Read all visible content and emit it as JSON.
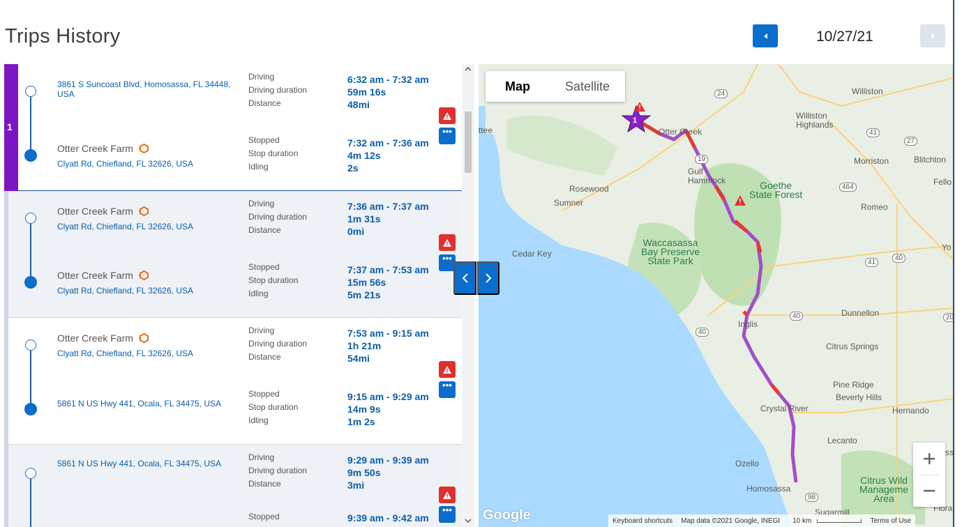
{
  "header": {
    "title": "Trips History",
    "date": "10/27/21"
  },
  "colors": {
    "accent": "#0b6dcc",
    "trip_highlight": "#7c16c4",
    "route": "#a24fc9",
    "route_alert": "#e8392f",
    "water": "#aadaff",
    "alert": "#e0302e"
  },
  "trips": [
    {
      "number": "1",
      "start_address": "3861 S Suncoast Blvd, Homosassa, FL 34448, USA",
      "drive_labels": [
        "Driving",
        "Driving duration",
        "Distance"
      ],
      "drive_values": [
        "6:32 am - 7:32 am",
        "59m 16s",
        "48mi"
      ],
      "stop_place": "Otter Creek Farm",
      "stop_address": "Clyatt Rd, Chiefland, FL 32626, USA",
      "stop_labels": [
        "Stopped",
        "Stop duration",
        "Idling"
      ],
      "stop_values": [
        "7:32 am - 7:36 am",
        "4m 12s",
        "2s"
      ]
    },
    {
      "start_place": "Otter Creek Farm",
      "start_address": "Clyatt Rd, Chiefland, FL 32626, USA",
      "drive_labels": [
        "Driving",
        "Driving duration",
        "Distance"
      ],
      "drive_values": [
        "7:36 am - 7:37 am",
        "1m 31s",
        "0mi"
      ],
      "stop_place": "Otter Creek Farm",
      "stop_address": "Clyatt Rd, Chiefland, FL 32626, USA",
      "stop_labels": [
        "Stopped",
        "Stop duration",
        "Idling"
      ],
      "stop_values": [
        "7:37 am - 7:53 am",
        "15m 56s",
        "5m 21s"
      ]
    },
    {
      "start_place": "Otter Creek Farm",
      "start_address": "Clyatt Rd, Chiefland, FL 32626, USA",
      "drive_labels": [
        "Driving",
        "Driving duration",
        "Distance"
      ],
      "drive_values": [
        "7:53 am - 9:15 am",
        "1h 21m",
        "54mi"
      ],
      "stop_address": "5861 N US Hwy 441, Ocala, FL 34475, USA",
      "stop_labels": [
        "Stopped",
        "Stop duration",
        "Idling"
      ],
      "stop_values": [
        "9:15 am - 9:29 am",
        "14m 9s",
        "1m 2s"
      ]
    },
    {
      "start_address": "5861 N US Hwy 441, Ocala, FL 34475, USA",
      "drive_labels": [
        "Driving",
        "Driving duration",
        "Distance"
      ],
      "drive_values": [
        "9:29 am - 9:39 am",
        "9m 50s",
        "3mi"
      ],
      "stop_labels": [
        "Stopped"
      ],
      "stop_values": [
        "9:39 am - 9:42 am"
      ]
    }
  ],
  "map": {
    "type_options": [
      "Map",
      "Satellite"
    ],
    "marker_number": "1",
    "places": {
      "williston": "Williston",
      "williston_highlands": "Williston\nHighlands",
      "otter_creek": "Otter Creek",
      "gulf_hammock": "Gulf\nHammock",
      "goethe": "Goethe\nState Forest",
      "rosewood": "Rosewood",
      "sumner": "Sumner",
      "cedar_key": "Cedar Key",
      "waccasassa": "Waccasassa\nBay Preserve\nState Park",
      "morriston": "Morriston",
      "blitchton": "Blitchton",
      "romeo": "Romeo",
      "dunnellon": "Dunnellon",
      "inglis": "Inglis",
      "citrus_springs": "Citrus Springs",
      "pine_ridge": "Pine Ridge",
      "beverly_hills": "Beverly Hills",
      "crystal_river": "Crystal River",
      "hernando": "Hernando",
      "lecanto": "Lecanto",
      "ozello": "Ozello",
      "homosassa": "Homosassa",
      "citrus_wild": "Citrus Wild\nManageme\nArea",
      "sugarmill": "Sugarmill",
      "ttee": "ttee",
      "fello": "Fello",
      "yo": "Yo",
      "flora": "Flora",
      "ss": "ss"
    },
    "roads": [
      "24",
      "41",
      "27",
      "464",
      "41",
      "40",
      "40",
      "19",
      "40",
      "98",
      "20"
    ],
    "google": "Google",
    "attribution": [
      "Keyboard shortcuts",
      "Map data ©2021 Google, INEGI",
      "10 km",
      "Terms of Use"
    ]
  }
}
